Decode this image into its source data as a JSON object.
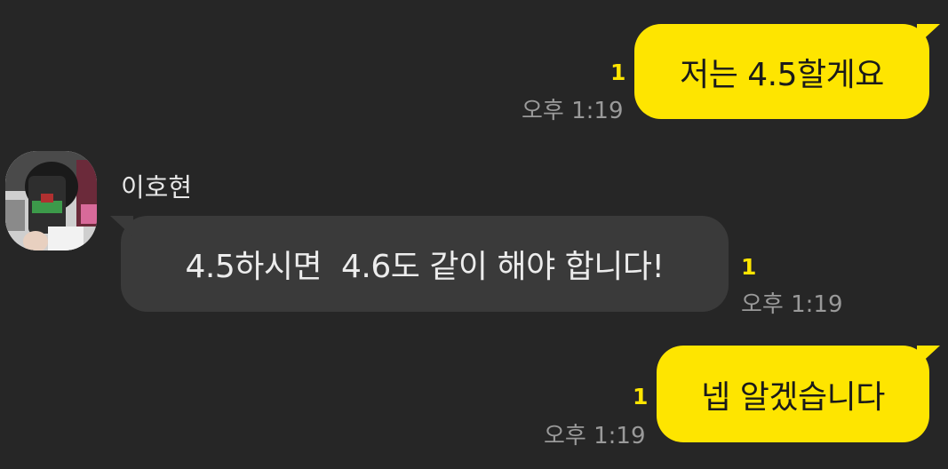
{
  "messages": [
    {
      "direction": "out",
      "text": "저는 4.5할게요",
      "unread": "1",
      "time": "오후 1:19"
    },
    {
      "direction": "in",
      "sender": "이호현",
      "text": "4.5하시면  4.6도 같이 해야 합니다!",
      "unread": "1",
      "time": "오후 1:19"
    },
    {
      "direction": "out",
      "text": "넵 알겠습니다",
      "unread": "1",
      "time": "오후 1:19"
    }
  ],
  "colors": {
    "background": "#262626",
    "outgoing_bubble": "#FEE500",
    "incoming_bubble": "#3a3a3a",
    "unread": "#FEE500"
  },
  "icons": {
    "avatar": "profile-photo"
  }
}
